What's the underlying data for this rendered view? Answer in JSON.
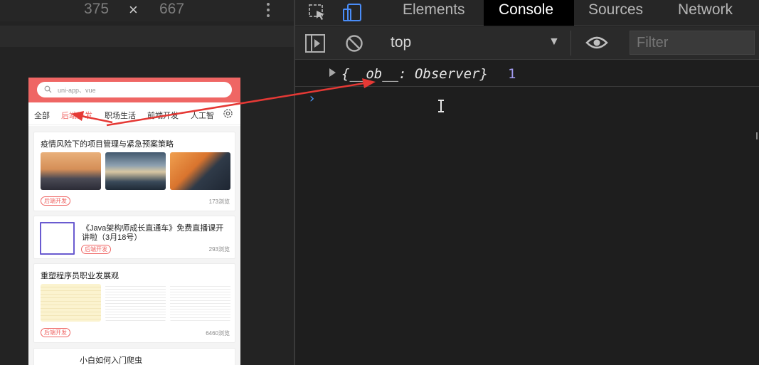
{
  "device_toolbar": {
    "width": "375",
    "separator": "×",
    "height": "667"
  },
  "phone": {
    "search_placeholder": "uni-app、vue",
    "tabs": [
      "全部",
      "后端开发",
      "职场生活",
      "前端开发",
      "人工智"
    ],
    "active_tab_index": 1,
    "accent_color": "#ef6664",
    "cards": [
      {
        "title": "疫情风险下的项目管理与紧急预案策略",
        "tag": "后端开发",
        "views": "173浏览"
      },
      {
        "title_line1": "《Java架构师成长直通车》免费直播课开",
        "title_line2": "讲啦（3月18号）",
        "tag": "后端开发",
        "views": "293浏览"
      },
      {
        "title": "重塑程序员职业发展观",
        "tag": "后端开发",
        "views": "6460浏览"
      },
      {
        "title": "小白如何入门爬虫"
      }
    ]
  },
  "devtools": {
    "tabs": [
      "Elements",
      "Console",
      "Sources",
      "Network"
    ],
    "active_tab": "Console",
    "context": "top",
    "filter_placeholder": "Filter",
    "log_object": "{__ob__: Observer}",
    "log_count": "1",
    "prompt_symbol": "›"
  }
}
